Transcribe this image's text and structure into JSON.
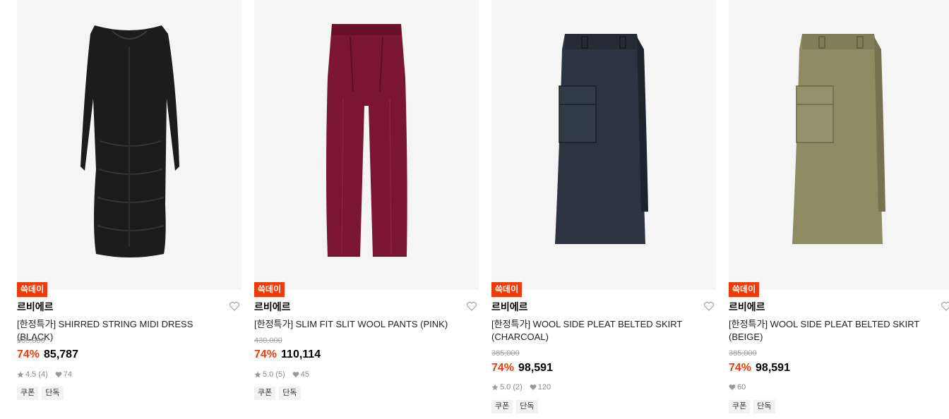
{
  "products": [
    {
      "badge": "쓱데이",
      "brand": "르비에르",
      "name": "[한정특가] SHIRRED STRING MIDI DRESS (BLACK)",
      "original_price": "335,000",
      "discount": "74%",
      "price": "85,787",
      "rating": "4.5 (4)",
      "likes": "74",
      "tags": [
        "쿠폰",
        "단독"
      ],
      "item_color": "#1c1c1c"
    },
    {
      "badge": "쓱데이",
      "brand": "르비에르",
      "name": "[한정특가] SLIM FIT SLIT WOOL PANTS (PINK)",
      "original_price": "430,000",
      "discount": "74%",
      "price": "110,114",
      "rating": "5.0 (5)",
      "likes": "45",
      "tags": [
        "쿠폰",
        "단독"
      ],
      "item_color": "#7a1633"
    },
    {
      "badge": "쓱데이",
      "brand": "르비에르",
      "name": "[한정특가] WOOL SIDE PLEAT BELTED SKIRT (CHARCOAL)",
      "original_price": "385,000",
      "discount": "74%",
      "price": "98,591",
      "rating": "5.0 (2)",
      "likes": "120",
      "tags": [
        "쿠폰",
        "단독"
      ],
      "item_color": "#2b3440"
    },
    {
      "badge": "쓱데이",
      "brand": "르비에르",
      "name": "[한정특가] WOOL SIDE PLEAT BELTED SKIRT (BEIGE)",
      "original_price": "385,000",
      "discount": "74%",
      "price": "98,591",
      "rating": "",
      "likes": "60",
      "tags": [
        "쿠폰",
        "단독"
      ],
      "item_color": "#8e8a62"
    }
  ],
  "colors": {
    "accent": "#f23a0a",
    "thumb_bg": "#f5f5f5",
    "tag_bg": "#f2f2f2"
  }
}
